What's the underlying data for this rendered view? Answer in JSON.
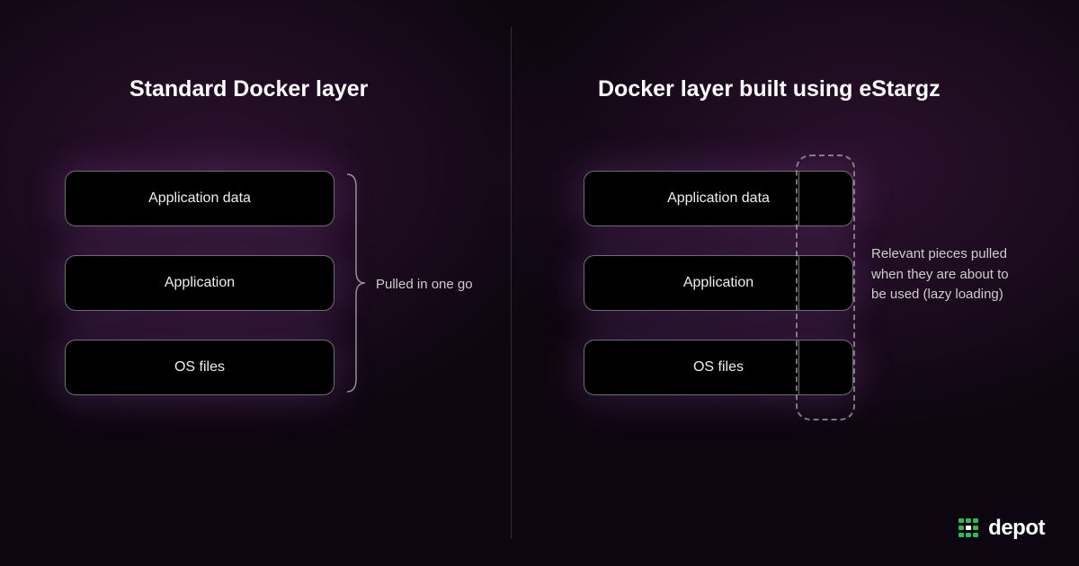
{
  "left": {
    "title": "Standard Docker layer",
    "layers": [
      "Application data",
      "Application",
      "OS files"
    ],
    "caption": "Pulled in one go"
  },
  "right": {
    "title": "Docker layer built using eStargz",
    "layers": [
      "Application data",
      "Application",
      "OS files"
    ],
    "caption": "Relevant pieces pulled when they are about to be used (lazy loading)"
  },
  "brand": "depot"
}
